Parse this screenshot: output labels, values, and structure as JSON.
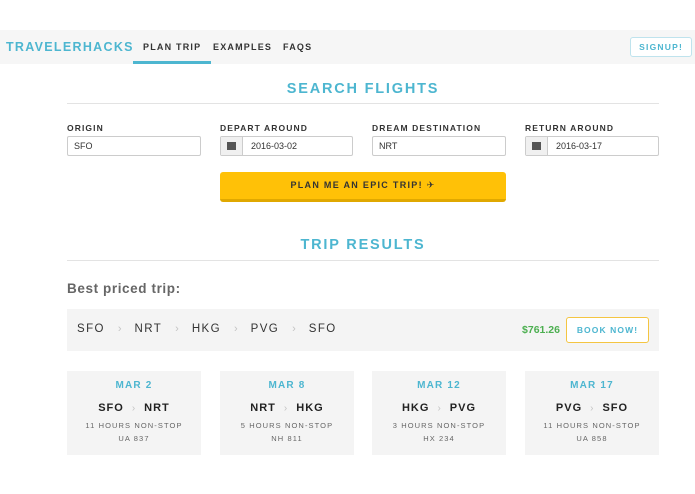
{
  "nav": {
    "brand": "TRAVELERHACKS",
    "items": [
      {
        "label": "PLAN TRIP"
      },
      {
        "label": "EXAMPLES"
      },
      {
        "label": "FAQS"
      }
    ],
    "signup_label": "SIGNUP!"
  },
  "search": {
    "title": "SEARCH FLIGHTS",
    "origin": {
      "label": "ORIGIN",
      "value": "SFO"
    },
    "depart": {
      "label": "DEPART AROUND",
      "value": "2016-03-02",
      "icon": "calendar-icon"
    },
    "destination": {
      "label": "DREAM DESTINATION",
      "value": "NRT"
    },
    "return": {
      "label": "RETURN AROUND",
      "value": "2016-03-17",
      "icon": "calendar-icon"
    },
    "cta_label": "PLAN ME AN EPIC TRIP! ✈"
  },
  "results": {
    "title": "TRIP RESULTS",
    "best_label": "Best priced trip:",
    "route": [
      "SFO",
      "NRT",
      "HKG",
      "PVG",
      "SFO"
    ],
    "route_separator": "›",
    "price": "$761.26",
    "price_color": "#4caf50",
    "book_label": "BOOK NOW!",
    "legs": [
      {
        "date": "MAR 2",
        "from": "SFO",
        "to": "NRT",
        "duration": "11 HOURS NON-STOP",
        "flight": "UA 837"
      },
      {
        "date": "MAR 8",
        "from": "NRT",
        "to": "HKG",
        "duration": "5 HOURS NON-STOP",
        "flight": "NH 811"
      },
      {
        "date": "MAR 12",
        "from": "HKG",
        "to": "PVG",
        "duration": "3 HOURS NON-STOP",
        "flight": "HX 234"
      },
      {
        "date": "MAR 17",
        "from": "PVG",
        "to": "SFO",
        "duration": "11 HOURS NON-STOP",
        "flight": "UA 858"
      }
    ]
  },
  "colors": {
    "accent": "#4db6d0",
    "cta": "#ffc107"
  }
}
